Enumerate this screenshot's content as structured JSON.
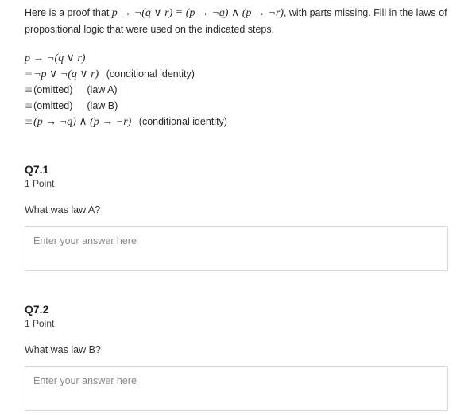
{
  "intro": {
    "prefix": "Here is a proof that ",
    "formula": "p → ¬(q ∨ r) ≡ (p → ¬q) ∧ (p → ¬r)",
    "suffix": ", with parts missing.  Fill in the laws of propositional logic that were used on the indicated steps."
  },
  "proof": {
    "eq_symbol": "≡",
    "lines": [
      {
        "formula": "p → ¬(q ∨ r)",
        "law": ""
      },
      {
        "formula": "¬p ∨ ¬(q ∨ r)",
        "law": "(conditional identity)"
      },
      {
        "formula": "(omitted)",
        "law": "(law A)"
      },
      {
        "formula": "(omitted)",
        "law": "(law B)"
      },
      {
        "formula": "(p → ¬q) ∧ (p → ¬r)",
        "law": "(conditional identity)"
      }
    ]
  },
  "questions": [
    {
      "title": "Q7.1",
      "points": "1 Point",
      "prompt": "What was law A?",
      "placeholder": "Enter your answer here",
      "value": ""
    },
    {
      "title": "Q7.2",
      "points": "1 Point",
      "prompt": "What was law B?",
      "placeholder": "Enter your answer here",
      "value": ""
    }
  ]
}
